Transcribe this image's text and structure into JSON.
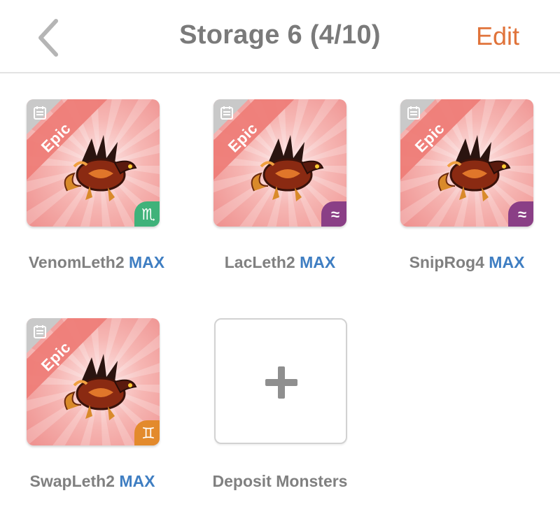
{
  "header": {
    "back_icon": "chevron-left-icon",
    "title": "Storage 6 (4/10)",
    "edit_label": "Edit",
    "edit_color": "#e0733a"
  },
  "rarity_label": "Epic",
  "max_color": "#3f7ec2",
  "monsters": [
    {
      "name": "VenomLeth2",
      "badge": "MAX",
      "element_icon": "scorpio-icon",
      "element_glyph": "♏",
      "element_color": "#3fb27a"
    },
    {
      "name": "LacLeth2",
      "badge": "MAX",
      "element_icon": "water-waves-icon",
      "element_glyph": "≈",
      "element_color": "#8a3f86"
    },
    {
      "name": "SnipRog4",
      "badge": "MAX",
      "element_icon": "water-waves-icon",
      "element_glyph": "≈",
      "element_color": "#8a3f86"
    },
    {
      "name": "SwapLeth2",
      "badge": "MAX",
      "element_icon": "gemini-icon",
      "element_glyph": "♊",
      "element_color": "#e38a2c"
    }
  ],
  "deposit": {
    "label": "Deposit Monsters",
    "icon": "plus-icon"
  }
}
